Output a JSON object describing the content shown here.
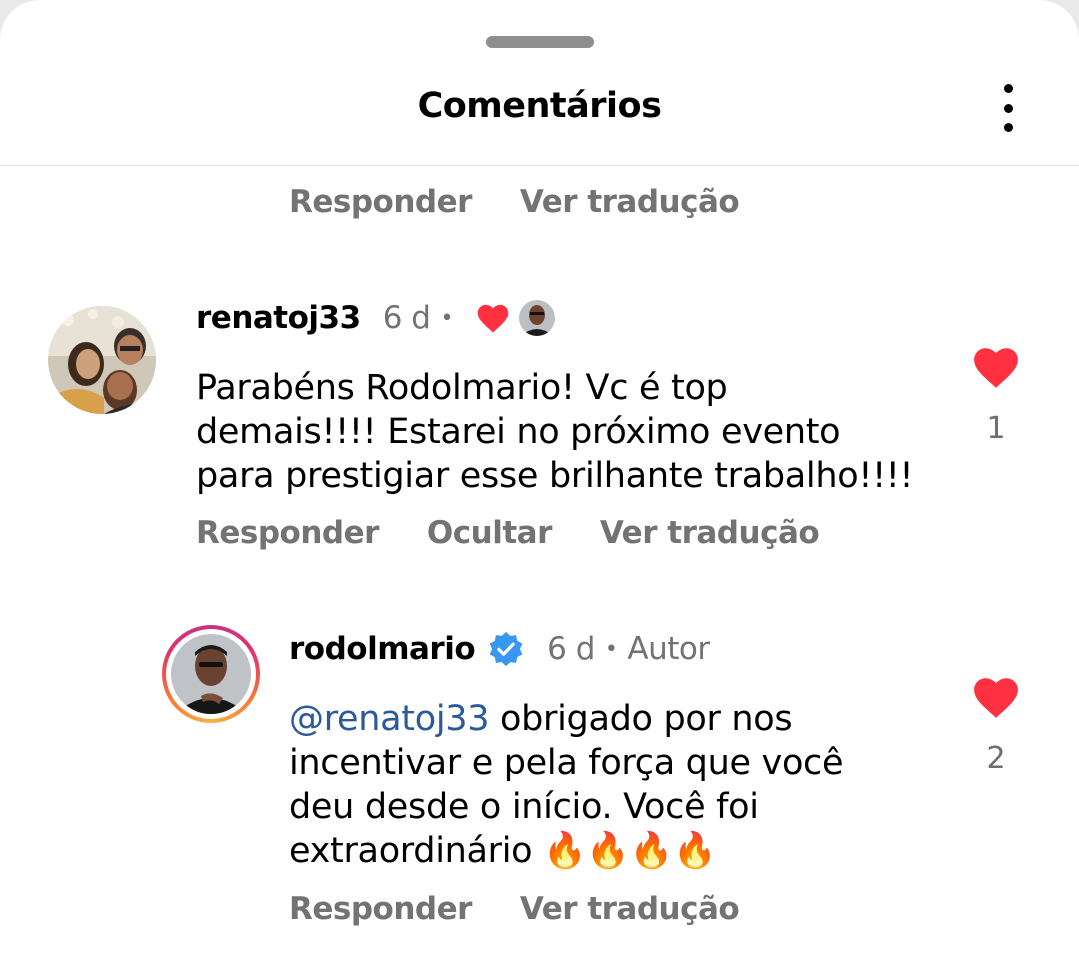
{
  "header": {
    "title": "Comentários"
  },
  "prev_comment": {
    "actions": [
      "Responder",
      "Ver tradução"
    ]
  },
  "comments": [
    {
      "username": "renatoj33",
      "age": "6 d",
      "text": "Parabéns Rodolmario! Vc é top demais!!!! Estarei no próximo evento para prestigiar esse brilhante trabalho!!!!",
      "likes": "1",
      "actions": [
        "Responder",
        "Ocultar",
        "Ver tradução"
      ],
      "liked_by_author": true
    },
    {
      "username": "rodolmario",
      "verified": true,
      "age": "6 d",
      "author_badge": "Autor",
      "mention": "@renatoj33",
      "text": " obrigado por nos incentivar e pela força que você deu desde o início. Você foi extraordinário 🔥🔥🔥🔥",
      "likes": "2",
      "actions": [
        "Responder",
        "Ver tradução"
      ]
    }
  ],
  "colors": {
    "heart": "#ff3040",
    "verified": "#3897f0",
    "muted": "#737373",
    "mention": "#2a5a9a"
  }
}
